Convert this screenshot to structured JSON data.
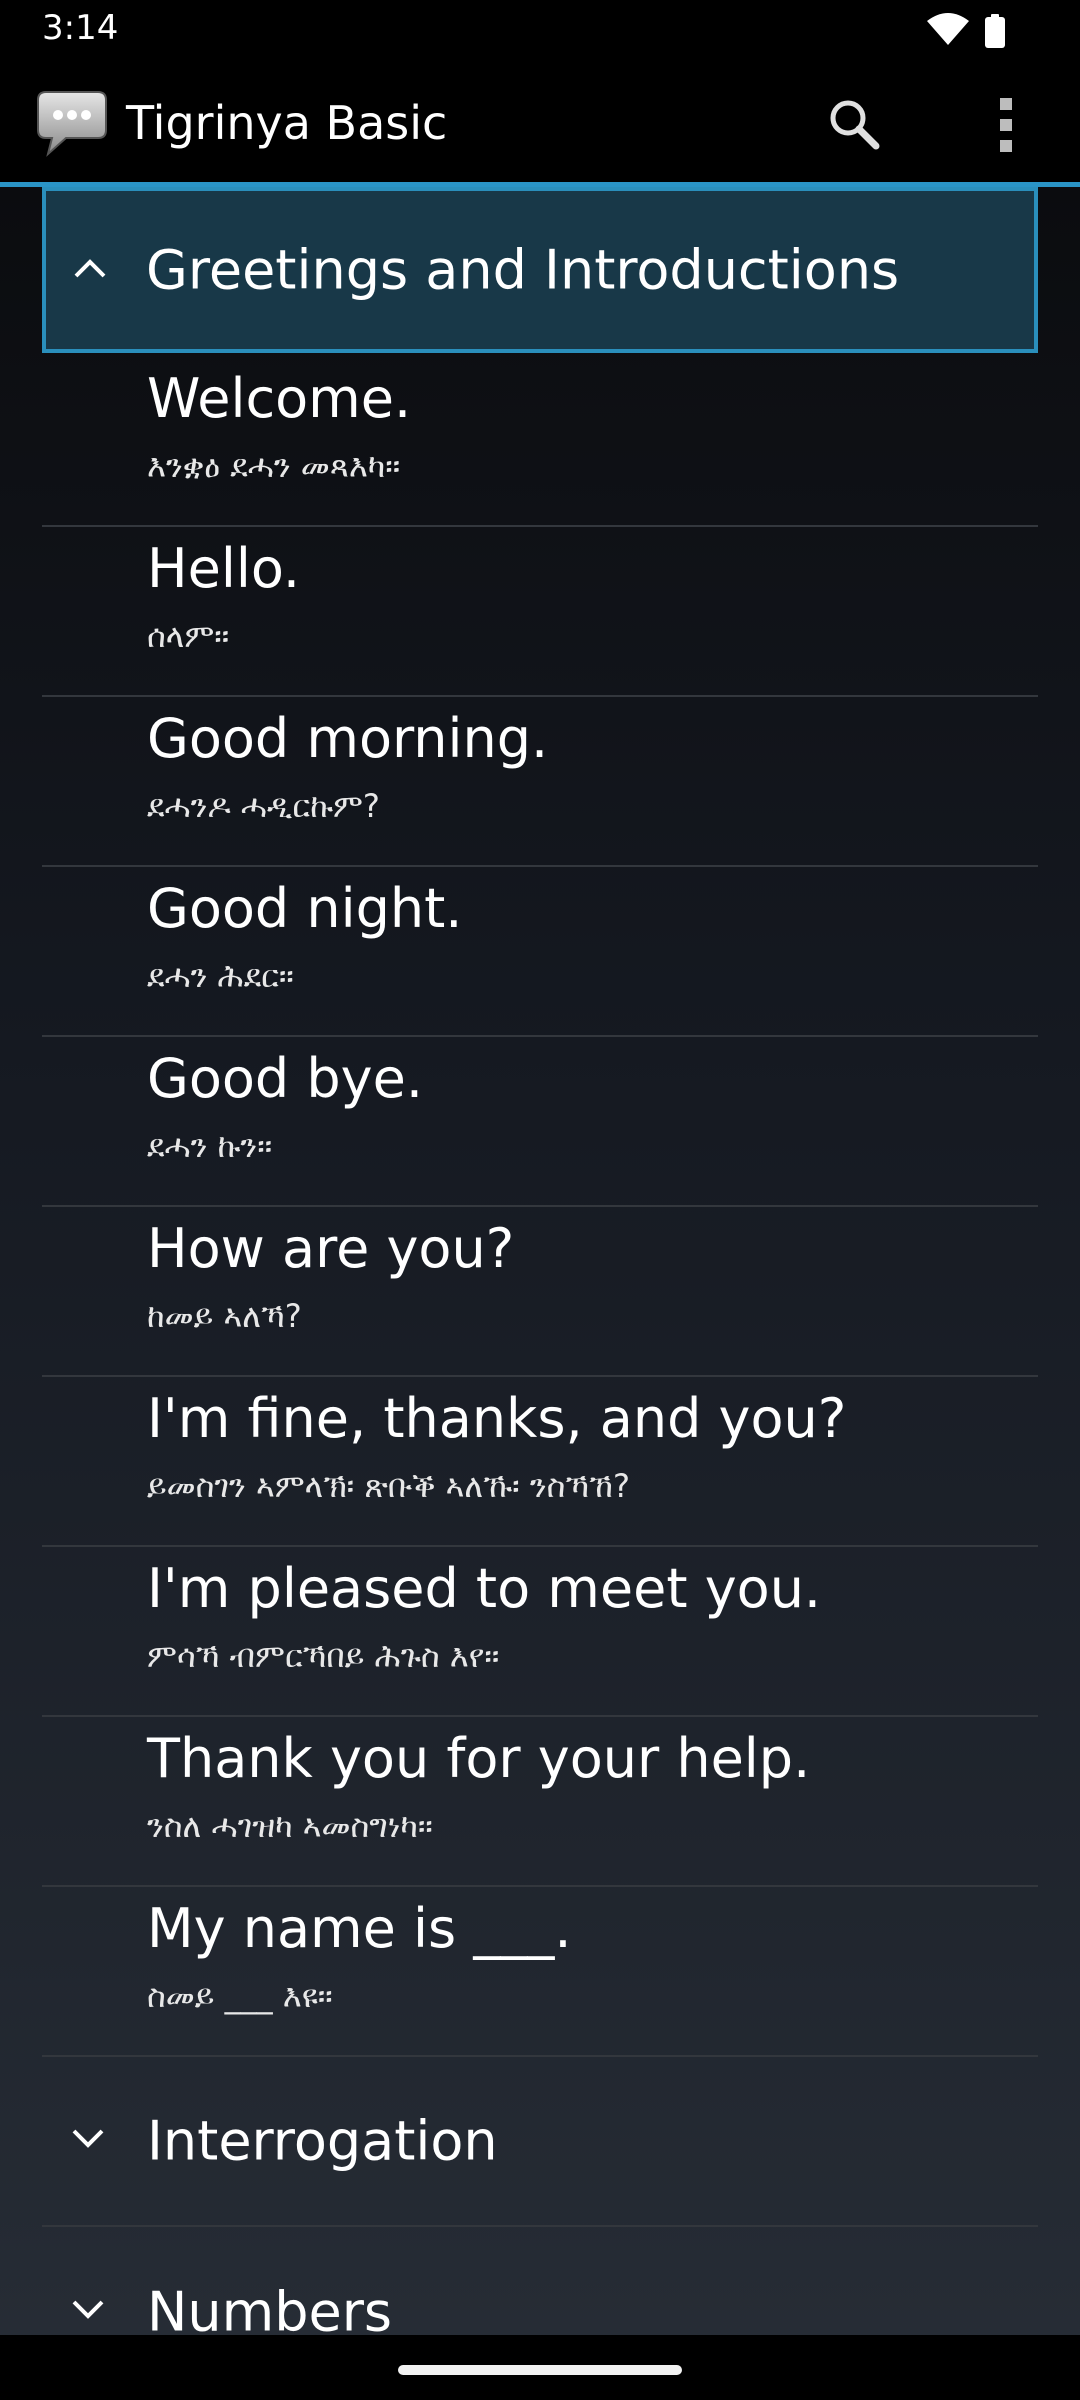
{
  "status_bar": {
    "time": "3:14",
    "icons": [
      "wifi-icon",
      "battery-icon"
    ]
  },
  "app_bar": {
    "title": "Tigrinya Basic",
    "logo_icon": "chat-bubble-icon",
    "actions": [
      "search-icon",
      "overflow-menu-icon"
    ],
    "accent_color": "#2a94c6"
  },
  "groups": [
    {
      "title": "Greetings and Introductions",
      "expanded": true,
      "phrases": [
        {
          "english": "Welcome.",
          "tigrinya": "እንቋዕ ደሓን መጻእካ።"
        },
        {
          "english": "Hello.",
          "tigrinya": "ሰላም።"
        },
        {
          "english": "Good morning.",
          "tigrinya": "ደሓንዶ ሓዲርኩም?"
        },
        {
          "english": "Good night.",
          "tigrinya": "ደሓን ሕደር።"
        },
        {
          "english": "Good bye.",
          "tigrinya": "ደሓን ኩን።"
        },
        {
          "english": "How are you?",
          "tigrinya": "ከመይ ኣለኻ?"
        },
        {
          "english": "I'm fine, thanks, and you?",
          "tigrinya": "ይመስገን ኣምላኽ፡ ጽቡቕ ኣለኹ፡ ንስኻኸ?"
        },
        {
          "english": "I'm pleased to meet you.",
          "tigrinya": "ምሳኻ ብምርኻበይ ሕጉስ እየ።"
        },
        {
          "english": "Thank you for your help.",
          "tigrinya": "ንስለ ሓገዝካ ኣመስግነካ።"
        },
        {
          "english": "My name is ___.",
          "tigrinya": "ስመይ ___ እዩ።"
        }
      ]
    },
    {
      "title": "Interrogation",
      "expanded": false
    },
    {
      "title": "Numbers",
      "expanded": false
    }
  ]
}
